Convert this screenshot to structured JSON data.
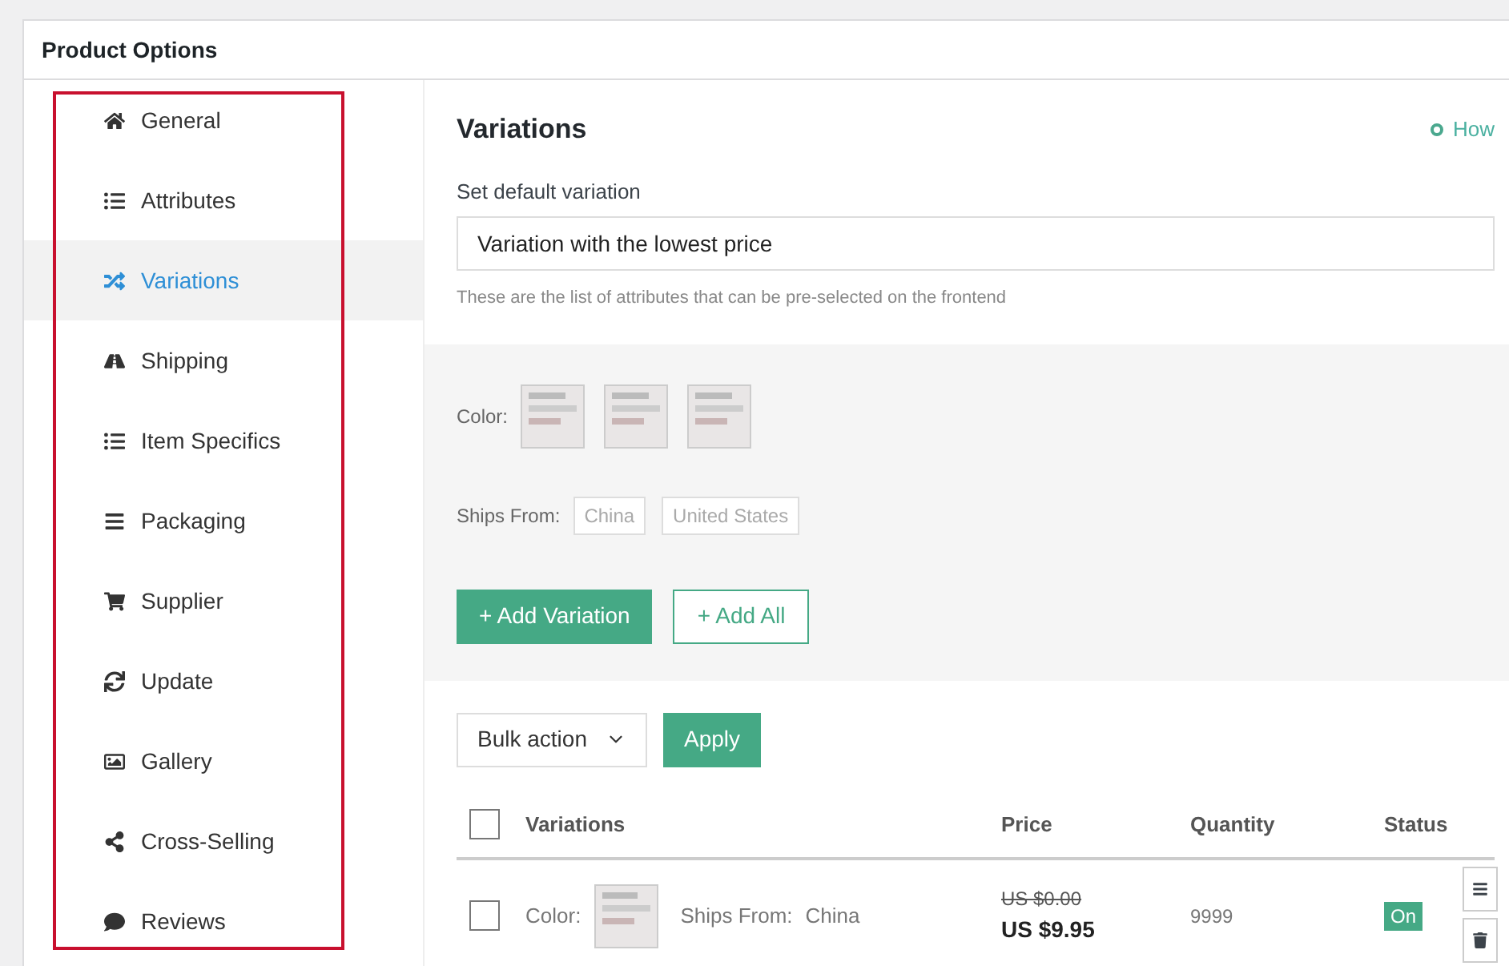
{
  "panel": {
    "title": "Product Options"
  },
  "sidebar": {
    "items": [
      {
        "label": "General",
        "selected": false
      },
      {
        "label": "Attributes",
        "selected": false
      },
      {
        "label": "Variations",
        "selected": true
      },
      {
        "label": "Shipping",
        "selected": false
      },
      {
        "label": "Item Specifics",
        "selected": false
      },
      {
        "label": "Packaging",
        "selected": false
      },
      {
        "label": "Supplier",
        "selected": false
      },
      {
        "label": "Update",
        "selected": false
      },
      {
        "label": "Gallery",
        "selected": false
      },
      {
        "label": "Cross-Selling",
        "selected": false
      },
      {
        "label": "Reviews",
        "selected": false
      }
    ]
  },
  "content": {
    "title": "Variations",
    "help_link": "How",
    "default_variation": {
      "label": "Set default variation",
      "value": "Variation with the lowest price",
      "hint": "These are the list of attributes that can be pre-selected on the frontend"
    },
    "attributes": {
      "color_label": "Color:",
      "ships_label": "Ships From:",
      "ships_options": [
        "China",
        "United States"
      ]
    },
    "buttons": {
      "add_variation": "+ Add Variation",
      "add_all": "+ Add All"
    },
    "bulk": {
      "value": "Bulk action",
      "apply": "Apply"
    },
    "table": {
      "select_all": {
        "checked": false
      },
      "columns": [
        "Variations",
        "Price",
        "Quantity",
        "Status"
      ],
      "rows": [
        {
          "checked": false,
          "color_label": "Color:",
          "ships_label": "Ships From:",
          "ships_value": "China",
          "old_price": "US $0.00",
          "price": "US $9.95",
          "quantity": "9999",
          "status": "On"
        }
      ]
    }
  }
}
